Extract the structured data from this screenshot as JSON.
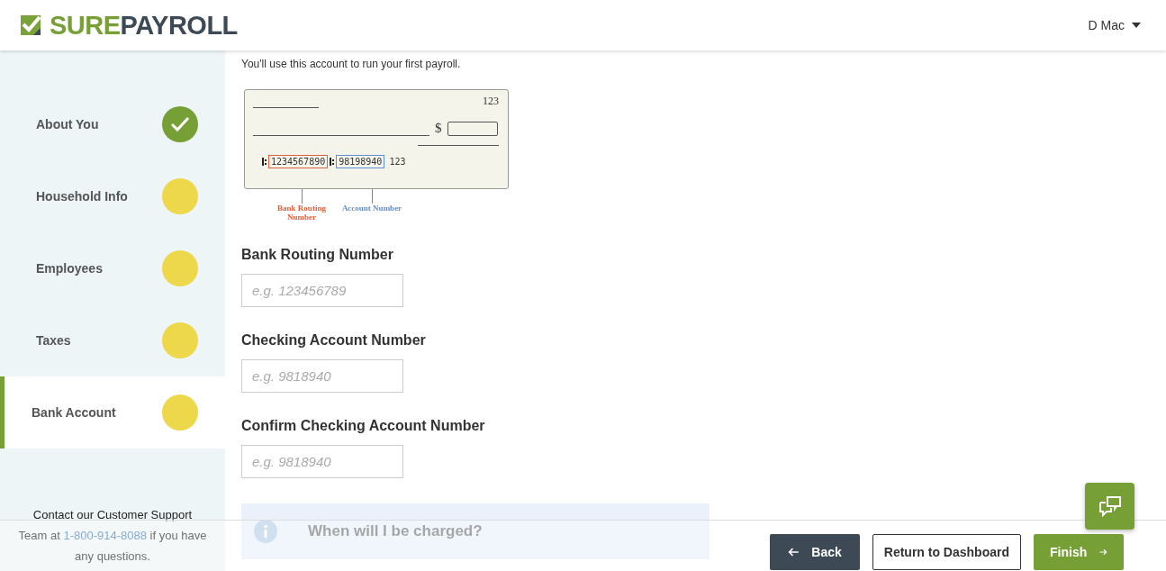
{
  "header": {
    "logo": {
      "part_1": "SURE",
      "part_2": "PAYROLL"
    },
    "user": "D Mac"
  },
  "sidebar": {
    "steps": [
      {
        "label": "About You",
        "completed": true,
        "selected": false
      },
      {
        "label": "Household Info",
        "completed": false,
        "selected": false
      },
      {
        "label": "Employees",
        "completed": false,
        "selected": false
      },
      {
        "label": "Taxes",
        "completed": false,
        "selected": false
      },
      {
        "label": "Bank Account",
        "completed": false,
        "selected": true
      }
    ],
    "support": {
      "before": "Contact our Customer Support Team at",
      "phone": "1-800-914-8088",
      "after": "if you have any questions."
    }
  },
  "main": {
    "intro": "You'll use this account to run your first payroll.",
    "check": {
      "number": "123",
      "currency": "$",
      "routing": "1234567890",
      "account": "98198940",
      "check_number": "123",
      "routing_label": "Bank Routing Number",
      "account_label": "Account Number"
    },
    "fields": [
      {
        "label": "Bank Routing Number",
        "placeholder": "e.g. 123456789"
      },
      {
        "label": "Checking Account Number",
        "placeholder": "e.g. 9818940"
      },
      {
        "label": "Confirm Checking Account Number",
        "placeholder": "e.g. 9818940"
      }
    ],
    "info": {
      "text": "When will I be charged?"
    }
  },
  "footer": {
    "buttons": [
      {
        "label": "Back",
        "kind": "back"
      },
      {
        "label": "Return to Dashboard",
        "kind": "outline"
      },
      {
        "label": "Finish",
        "kind": "finish"
      }
    ]
  }
}
